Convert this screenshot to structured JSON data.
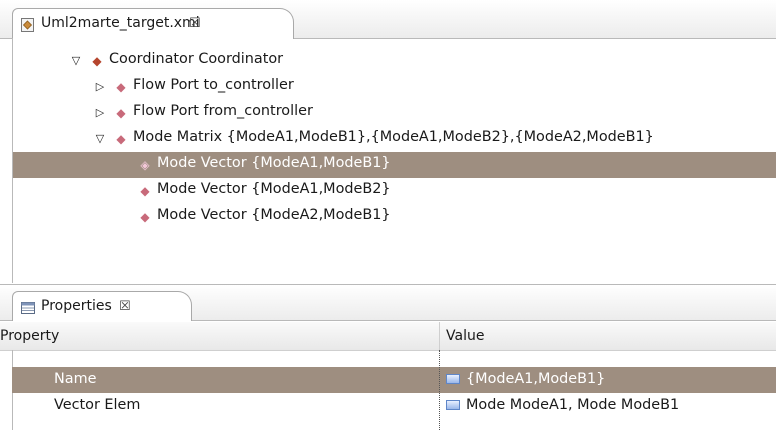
{
  "editor": {
    "tab_title": "Uml2marte_target.xmi",
    "close_glyph": "☒",
    "tree": [
      {
        "label": "Coordinator Coordinator",
        "twisty": "expanded",
        "selected": false
      },
      {
        "label": "Flow Port to_controller",
        "twisty": "collapsed",
        "selected": false
      },
      {
        "label": "Flow Port from_controller",
        "twisty": "collapsed",
        "selected": false
      },
      {
        "label": "Mode Matrix {ModeA1,ModeB1},{ModeA1,ModeB2},{ModeA2,ModeB1}",
        "twisty": "expanded",
        "selected": false
      },
      {
        "label": "Mode Vector {ModeA1,ModeB1}",
        "twisty": "none",
        "selected": true
      },
      {
        "label": "Mode Vector {ModeA1,ModeB2}",
        "twisty": "none",
        "selected": false
      },
      {
        "label": "Mode Vector {ModeA2,ModeB1}",
        "twisty": "none",
        "selected": false
      }
    ]
  },
  "properties": {
    "tab_title": "Properties",
    "close_glyph": "☒",
    "col_property": "Property",
    "col_value": "Value",
    "rows": [
      {
        "name": "Name",
        "value": "{ModeA1,ModeB1}",
        "selected": true
      },
      {
        "name": "Vector Elem",
        "value": "Mode ModeA1, Mode ModeB1",
        "selected": false
      }
    ]
  },
  "colors": {
    "selection": "#9e8e80",
    "node_icon": "#c0392b"
  }
}
